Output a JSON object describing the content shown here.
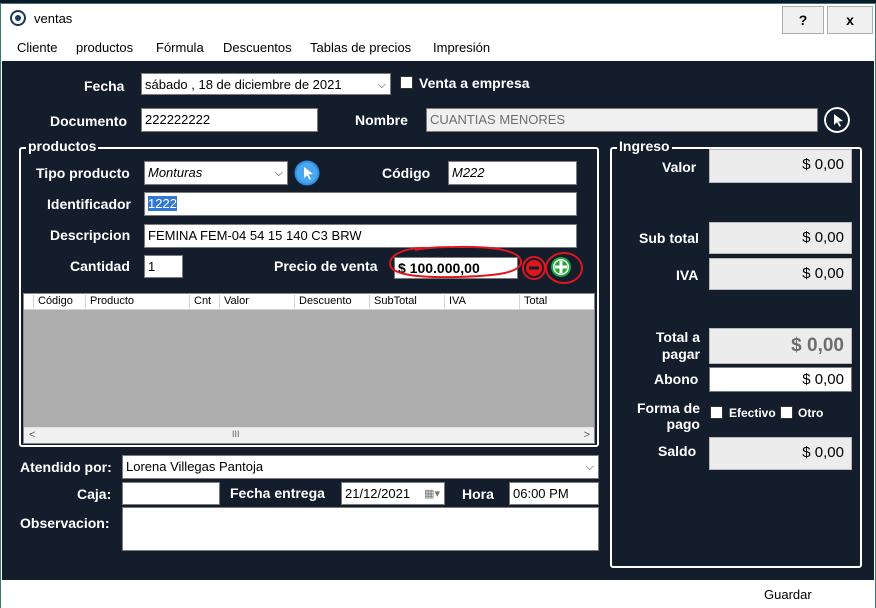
{
  "window": {
    "title": "ventas",
    "help_label": "?",
    "close_label": "x"
  },
  "menu": [
    "Cliente",
    "productos",
    "Fórmula",
    "Descuentos",
    "Tablas de precios",
    "Impresión"
  ],
  "header": {
    "fecha_label": "Fecha",
    "fecha_value": "sábado , 18 de  diciembre  de 2021",
    "venta_empresa_label": "Venta a empresa",
    "documento_label": "Documento",
    "documento_value": "222222222",
    "nombre_label": "Nombre",
    "nombre_value": "CUANTIAS MENORES"
  },
  "productos": {
    "group_title": "productos",
    "tipo_label": "Tipo producto",
    "tipo_value": "Monturas",
    "codigo_label": "Código",
    "codigo_value": "M222",
    "identificador_label": "Identificador",
    "identificador_value": "1222",
    "descripcion_label": "Descripcion",
    "descripcion_value": "FEMINA FEM-04 54 15 140 C3 BRW",
    "cantidad_label": "Cantidad",
    "cantidad_value": "1",
    "precio_label": "Precio de venta",
    "precio_value": "$ 100.000,00",
    "columns": [
      "Código",
      "Producto",
      "Cnt",
      "Valor",
      "Descuento",
      "SubTotal",
      "IVA",
      "Total"
    ],
    "scroll_left": "<",
    "scroll_right": ">",
    "scroll_thumb": "III"
  },
  "bottom": {
    "atendido_label": "Atendido por:",
    "atendido_value": "Lorena Villegas Pantoja",
    "caja_label": "Caja:",
    "caja_value": "",
    "fecha_entrega_label": "Fecha entrega",
    "fecha_entrega_value": "21/12/2021",
    "hora_label": "Hora",
    "hora_value": "06:00 PM",
    "observacion_label": "Observacion:",
    "observacion_value": ""
  },
  "ingreso": {
    "group_title": "Ingreso",
    "valor_label": "Valor",
    "valor_value": "$ 0,00",
    "subtotal_label": "Sub total",
    "subtotal_value": "$ 0,00",
    "iva_label": "IVA",
    "iva_value": "$ 0,00",
    "total_label_1": "Total a",
    "total_label_2": "pagar",
    "total_value": "$ 0,00",
    "abono_label": "Abono",
    "abono_value": "$ 0,00",
    "forma_label_1": "Forma de",
    "forma_label_2": "pago",
    "efectivo_label": "Efectivo",
    "otro_label": "Otro",
    "saldo_label": "Saldo",
    "saldo_value": "$ 0,00"
  },
  "footer": {
    "guardar_label": "Guardar"
  },
  "colors": {
    "panel": "#141d2c",
    "accent": "#2f8fe0",
    "annotation": "#e0161e",
    "add": "#22a83a"
  }
}
